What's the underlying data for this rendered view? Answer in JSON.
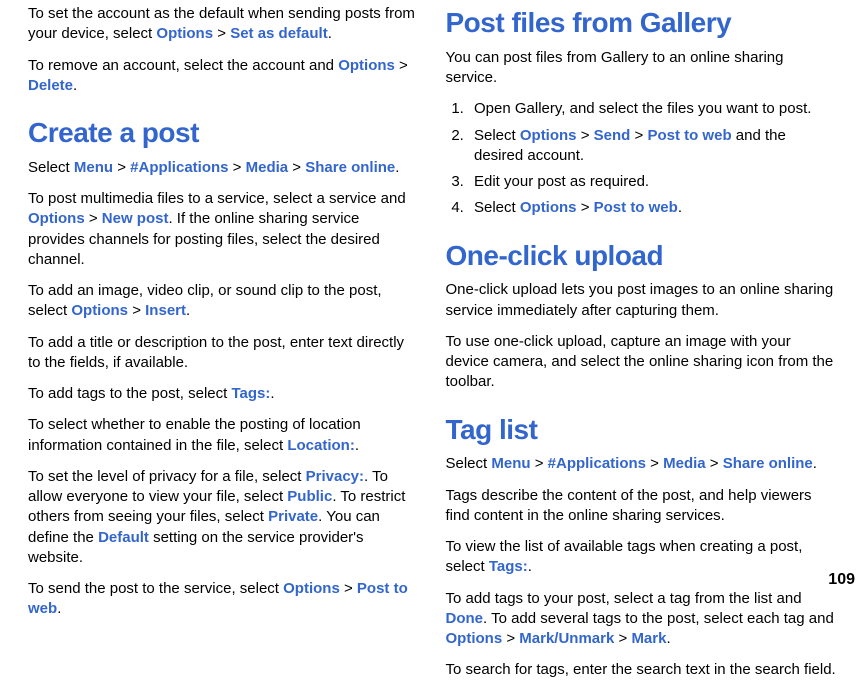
{
  "page_number": "109",
  "left": {
    "p1": {
      "t1": "To set the account as the default when sending posts from your device, select ",
      "k1": "Options",
      "s1": " > ",
      "k2": "Set as default",
      "t2": "."
    },
    "p2": {
      "t1": "To remove an account, select the account and ",
      "k1": "Options",
      "s1": " > ",
      "k2": "Delete",
      "t2": "."
    },
    "h1": "Create a post",
    "p3": {
      "t1": "Select ",
      "k1": "Menu",
      "s1": " > ",
      "k2": "#Applications",
      "s2": " > ",
      "k3": "Media",
      "s3": " > ",
      "k4": "Share online",
      "t2": "."
    },
    "p4": {
      "t1": "To post multimedia files to a service, select a service and ",
      "k1": "Options",
      "s1": " > ",
      "k2": "New post",
      "t2": ". If the online sharing service provides channels for posting files, select the desired channel."
    },
    "p5": {
      "t1": "To add an image, video clip, or sound clip to the post, select ",
      "k1": "Options",
      "s1": " > ",
      "k2": "Insert",
      "t2": "."
    },
    "p6": "To add a title or description to the post, enter text directly to the fields, if available.",
    "p7": {
      "t1": "To add tags to the post, select ",
      "k1": "Tags:",
      "t2": "."
    },
    "p8": {
      "t1": "To select whether to enable the posting of location information contained in the file, select ",
      "k1": "Location:",
      "t2": "."
    },
    "p9": {
      "t1": "To set the level of privacy for a file, select ",
      "k1": "Privacy:",
      "t2": ". To allow everyone to view your file, select ",
      "k2": "Public",
      "t3": ". To restrict others from seeing your files, select ",
      "k3": "Private",
      "t4": ". You can define the ",
      "k4": "Default",
      "t5": " setting on the service provider's website."
    },
    "p10": {
      "t1": "To send the post to the service, select ",
      "k1": "Options",
      "s1": " > ",
      "k2": "Post to web",
      "t2": "."
    }
  },
  "right": {
    "h1": "Post files from Gallery",
    "p1": "You can post files from Gallery to an online sharing service.",
    "ol1": {
      "i1": "Open Gallery, and select the files you want to post.",
      "i2": {
        "t1": "Select ",
        "k1": "Options",
        "s1": " > ",
        "k2": "Send",
        "s2": " > ",
        "k3": "Post to web",
        "t2": " and the desired account."
      },
      "i3": "Edit your post as required.",
      "i4": {
        "t1": "Select ",
        "k1": "Options",
        "s1": " > ",
        "k2": "Post to web",
        "t2": "."
      }
    },
    "h2": "One-click upload",
    "p2": "One-click upload lets you post images to an online sharing service immediately after capturing them.",
    "p3": "To use one-click upload, capture an image with your device camera, and select the online sharing icon from the toolbar.",
    "h3": "Tag list",
    "p4": {
      "t1": "Select ",
      "k1": "Menu",
      "s1": " > ",
      "k2": "#Applications",
      "s2": " > ",
      "k3": "Media",
      "s3": " > ",
      "k4": "Share online",
      "t2": "."
    },
    "p5": "Tags describe the content of the post, and help viewers find content in the online sharing services.",
    "p6": {
      "t1": "To view the list of available tags when creating a post, select ",
      "k1": "Tags:",
      "t2": "."
    },
    "p7": {
      "t1": "To add tags to your post, select a tag from the list and ",
      "k1": "Done",
      "t2": ". To add several tags to the post, select each tag and ",
      "k2": "Options",
      "s1": " > ",
      "k3": "Mark/Unmark",
      "s2": " > ",
      "k4": "Mark",
      "t3": "."
    },
    "p8": "To search for tags, enter the search text in the search field."
  }
}
